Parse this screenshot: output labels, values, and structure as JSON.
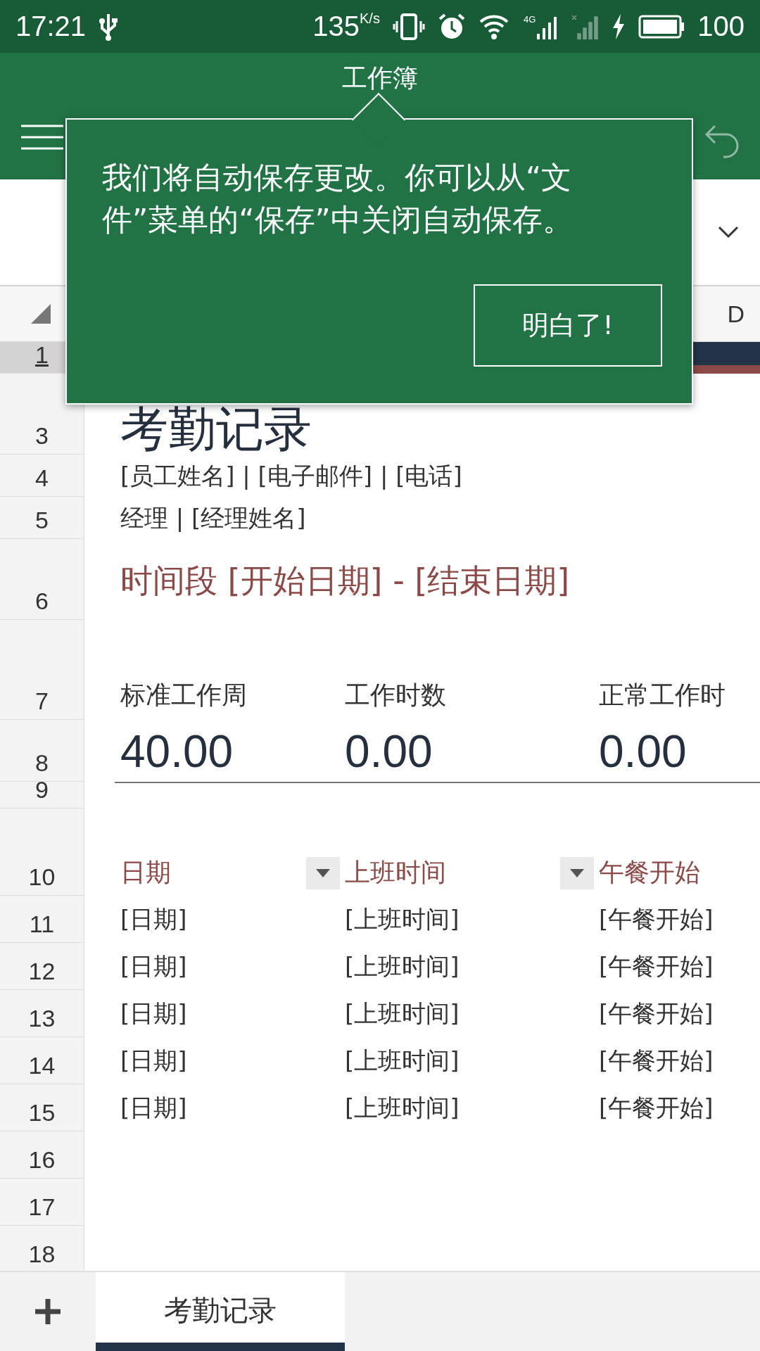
{
  "status_bar": {
    "time": "17:21",
    "speed": "135",
    "speed_unit": "K/s",
    "network_type": "4G",
    "battery": "100"
  },
  "app_bar": {
    "title": "工作簿"
  },
  "tooltip": {
    "message": "我们将自动保存更改。你可以从“文件”菜单的“保存”中关闭自动保存。",
    "button": "明白了!"
  },
  "column_header": {
    "visible_column": "D"
  },
  "row_headers": [
    {
      "label": "1",
      "selected": true
    },
    {
      "label": "3",
      "selected": false
    },
    {
      "label": "4",
      "selected": false
    },
    {
      "label": "5",
      "selected": false
    },
    {
      "label": "6",
      "selected": false
    },
    {
      "label": "7",
      "selected": false
    },
    {
      "label": "8",
      "selected": false
    },
    {
      "label": "9",
      "selected": false
    },
    {
      "label": "10",
      "selected": false
    },
    {
      "label": "11",
      "selected": false
    },
    {
      "label": "12",
      "selected": false
    },
    {
      "label": "13",
      "selected": false
    },
    {
      "label": "14",
      "selected": false
    },
    {
      "label": "15",
      "selected": false
    },
    {
      "label": "16",
      "selected": false
    },
    {
      "label": "17",
      "selected": false
    },
    {
      "label": "18",
      "selected": false
    }
  ],
  "sheet": {
    "title": "考勤记录",
    "employee_line": "[员工姓名] | [电子邮件] | [电话]",
    "manager_line": "经理 | [经理姓名]",
    "period": "时间段 [开始日期] - [结束日期]",
    "stats": [
      {
        "label": "标准工作周",
        "value": "40.00"
      },
      {
        "label": "工作时数",
        "value": "0.00"
      },
      {
        "label": "正常工作时",
        "value": "0.00"
      }
    ],
    "table": {
      "columns": [
        {
          "label": "日期",
          "filter_button": true
        },
        {
          "label": "上班时间",
          "filter_button": true
        },
        {
          "label": "午餐开始",
          "filter_button": false
        }
      ],
      "rows": [
        [
          "[日期]",
          "[上班时间]",
          "[午餐开始]"
        ],
        [
          "[日期]",
          "[上班时间]",
          "[午餐开始]"
        ],
        [
          "[日期]",
          "[上班时间]",
          "[午餐开始]"
        ],
        [
          "[日期]",
          "[上班时间]",
          "[午餐开始]"
        ],
        [
          "[日期]",
          "[上班时间]",
          "[午餐开始]"
        ]
      ]
    }
  },
  "sheet_tabs": [
    {
      "label": "考勤记录",
      "selected": true
    }
  ]
}
